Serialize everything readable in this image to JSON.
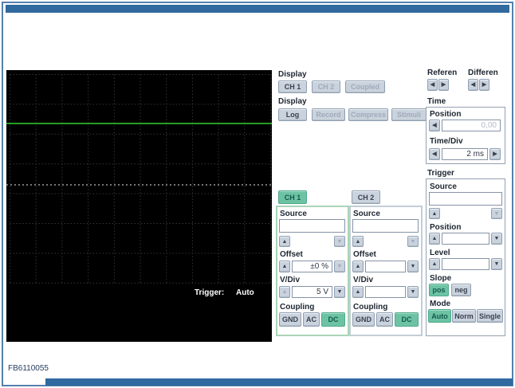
{
  "footer": {
    "label": "FB6110055"
  },
  "scope": {
    "trigger_label": "Trigger:",
    "trigger_mode": "Auto"
  },
  "icons": {
    "left": "◀",
    "right": "▶",
    "up": "▲",
    "down": "▼"
  },
  "display_channel": {
    "title": "Display",
    "ch1": "CH 1",
    "ch2": "CH 2",
    "coupled": "Coupled"
  },
  "display_mode": {
    "title": "Display",
    "log": "Log",
    "record": "Record",
    "compress": "Compress",
    "stimuli": "Stimuli"
  },
  "reference": {
    "title": "Referen"
  },
  "difference": {
    "title": "Differen"
  },
  "time": {
    "title": "Time",
    "position_label": "Position",
    "position_value": "0,00",
    "timediv_label": "Time/Div",
    "timediv_value": "2 ms"
  },
  "trigger": {
    "title": "Trigger",
    "source_label": "Source",
    "source_value": "",
    "position_label": "Position",
    "position_value": "",
    "level_label": "Level",
    "level_value": "",
    "slope_label": "Slope",
    "slope_pos": "pos",
    "slope_neg": "neg",
    "mode_label": "Mode",
    "mode_auto": "Auto",
    "mode_norm": "Norm",
    "mode_single": "Single"
  },
  "channels": {
    "ch1": {
      "tab": "CH 1",
      "source_label": "Source",
      "source_value": "",
      "offset_label": "Offset",
      "offset_value": "±0 %",
      "vdiv_label": "V/Div",
      "vdiv_value": "5 V",
      "coupling_label": "Coupling",
      "gnd": "GND",
      "ac": "AC",
      "dc": "DC"
    },
    "ch2": {
      "tab": "CH 2",
      "source_label": "Source",
      "source_value": "",
      "offset_label": "Offset",
      "offset_value": "",
      "vdiv_label": "V/Div",
      "vdiv_value": "",
      "coupling_label": "Coupling",
      "gnd": "GND",
      "ac": "AC",
      "dc": "DC"
    }
  },
  "colors": {
    "accent_teal": "#6cc3a4",
    "frame_blue": "#306a9e",
    "trace_green": "#2fd42f"
  }
}
